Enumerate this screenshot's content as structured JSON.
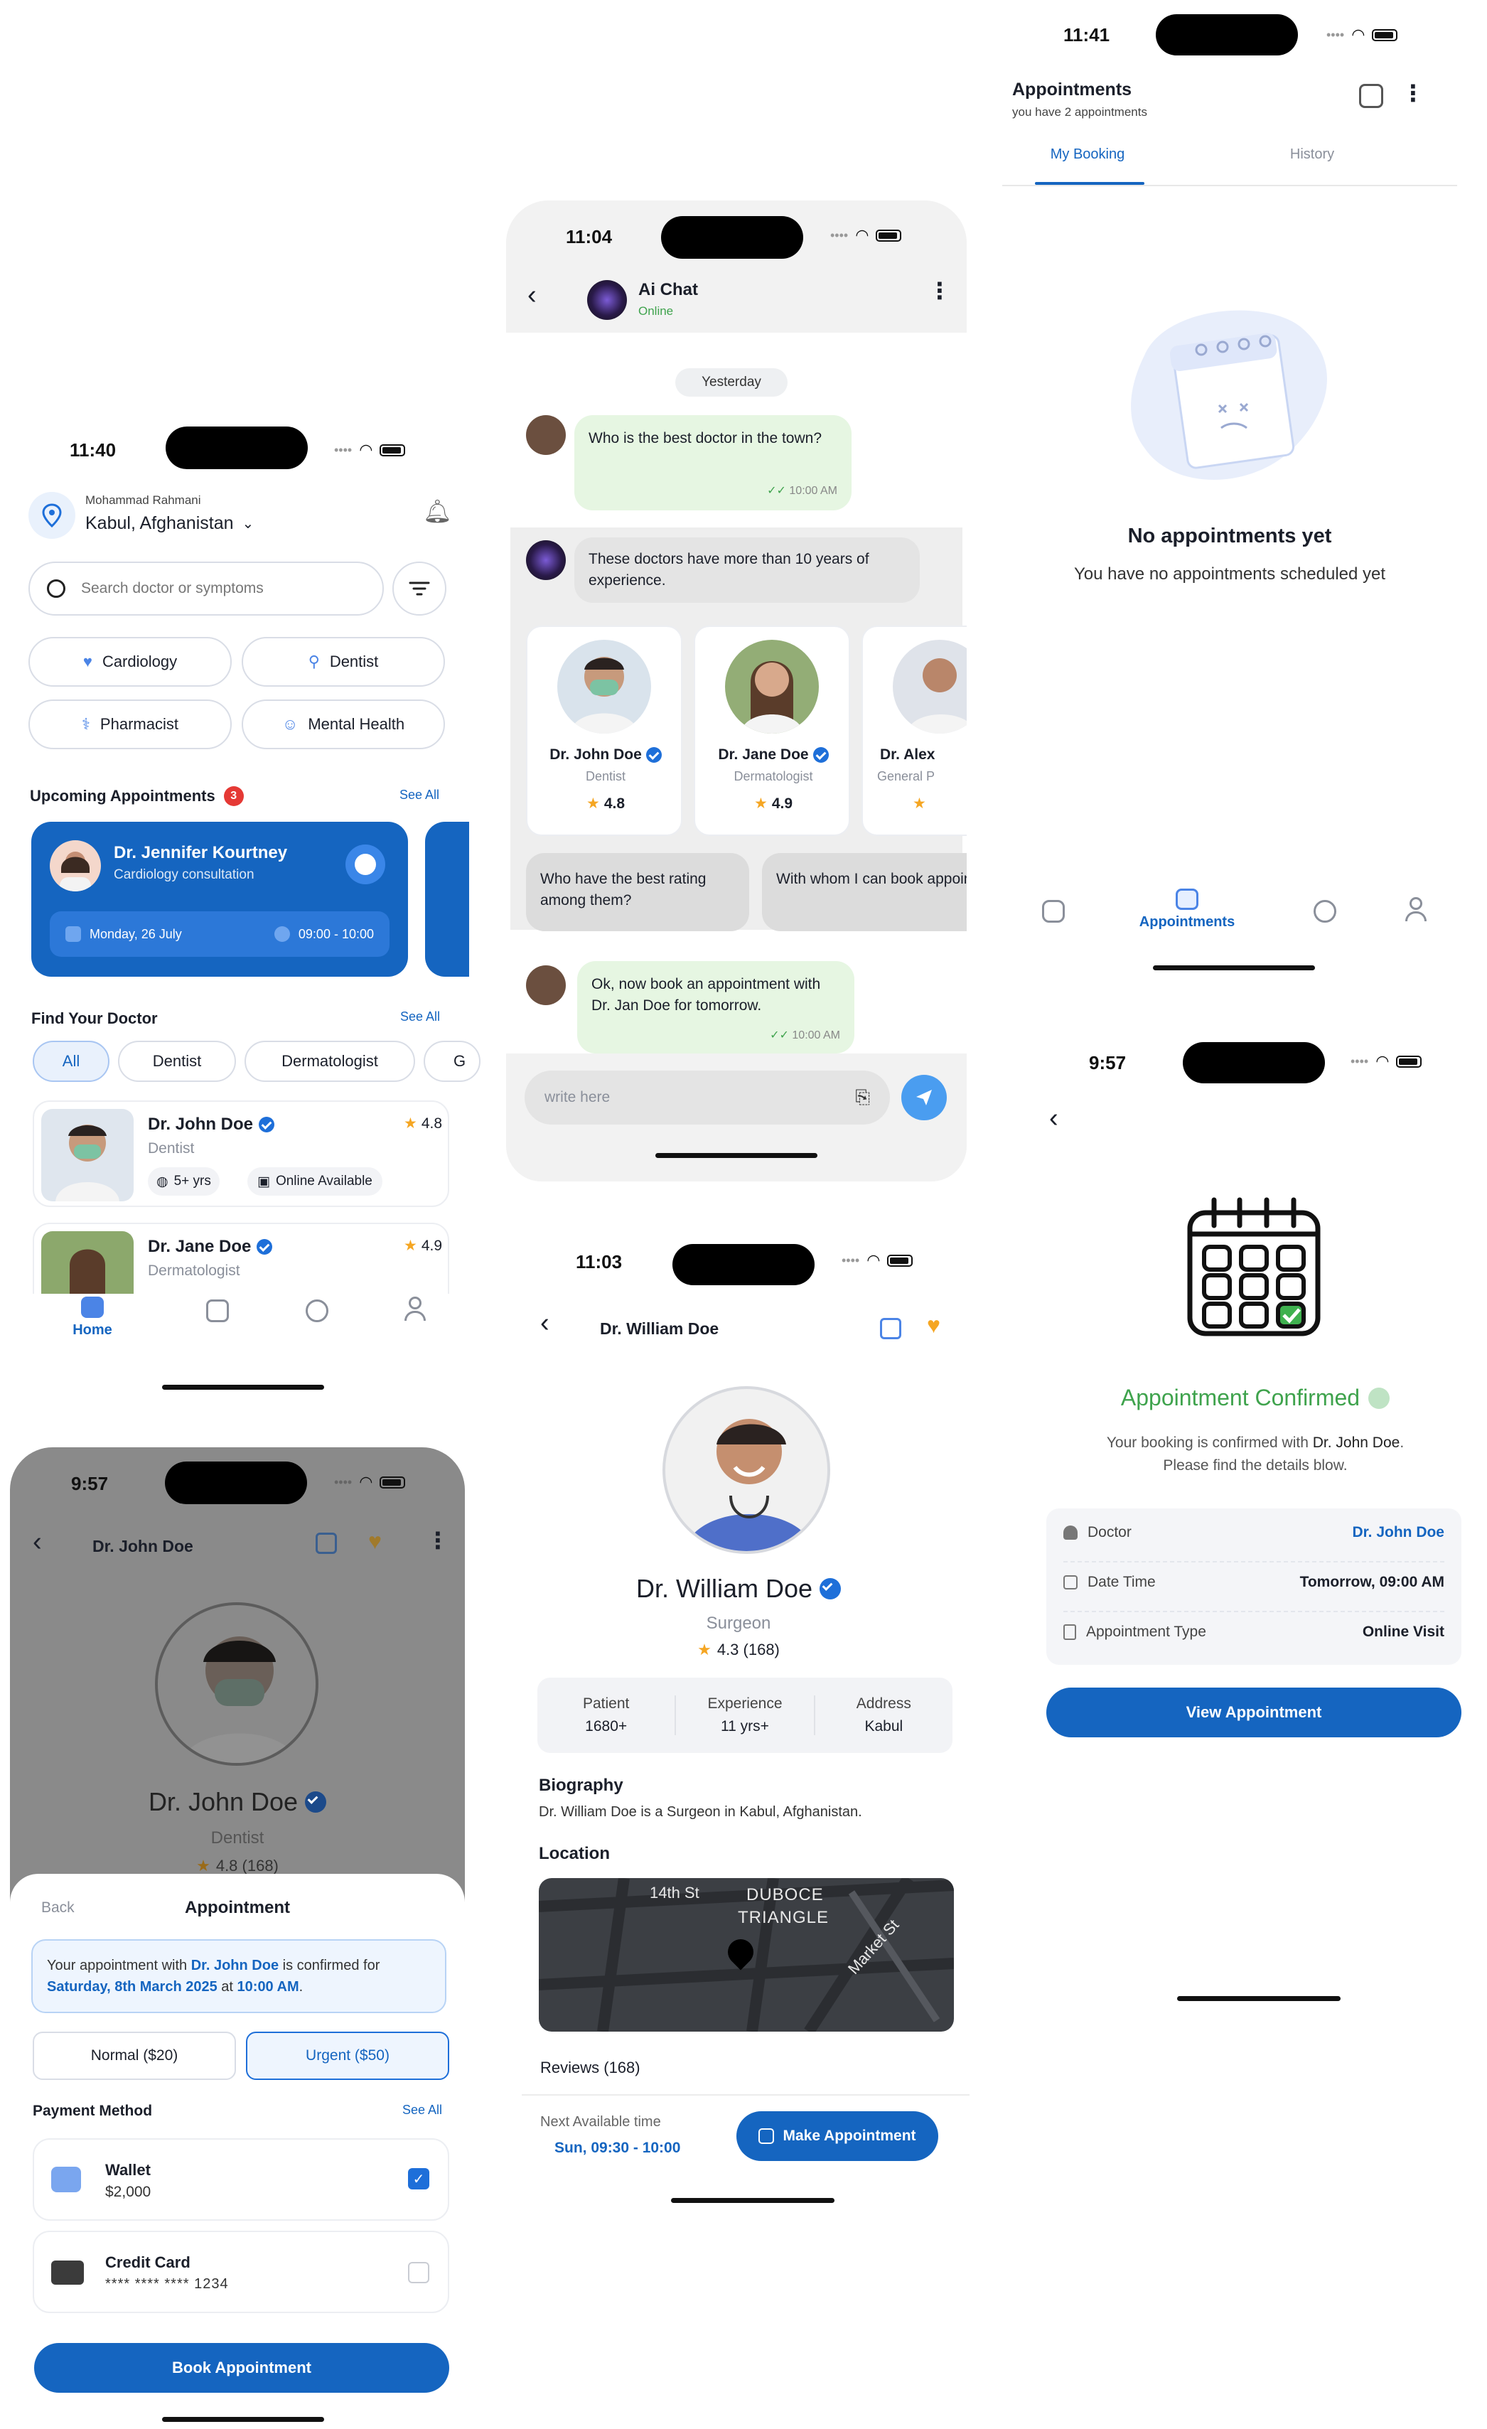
{
  "home": {
    "time": "11:40",
    "user_name": "Mohammad Rahmani",
    "location": "Kabul, Afghanistan",
    "search_placeholder": "Search doctor or symptoms",
    "categories": [
      "Cardiology",
      "Dentist",
      "Pharmacist",
      "Mental Health"
    ],
    "upcoming_title": "Upcoming Appointments",
    "upcoming_count": "3",
    "see_all": "See All",
    "appt": {
      "doctor": "Dr. Jennifer Kourtney",
      "type": "Cardiology consultation",
      "date": "Monday, 26 July",
      "time": "09:00 - 10:00"
    },
    "find_title": "Find Your Doctor",
    "filters": [
      "All",
      "Dentist",
      "Dermatologist",
      "G"
    ],
    "doctors": [
      {
        "name": "Dr. John Doe",
        "specialty": "Dentist",
        "rating": "4.8",
        "experience": "5+ yrs",
        "availability": "Online Available"
      },
      {
        "name": "Dr. Jane Doe",
        "specialty": "Dermatologist",
        "rating": "4.9"
      }
    ],
    "nav_home": "Home"
  },
  "chat": {
    "time": "11:04",
    "title": "Ai Chat",
    "status": "Online",
    "day": "Yesterday",
    "msg1": "Who is the best doctor in the town?",
    "msg1_time": "10:00 AM",
    "reply1": "These doctors have more than 10 years of experience.",
    "cards": [
      {
        "name": "Dr. John Doe",
        "specialty": "Dentist",
        "rating": "4.8"
      },
      {
        "name": "Dr. Jane Doe",
        "specialty": "Dermatologist",
        "rating": "4.9"
      },
      {
        "name": "Dr. Alex",
        "specialty": "General P"
      }
    ],
    "suggest1": "Who have the best rating among them?",
    "suggest2": "With whom I can book appointment today?",
    "msg2": "Ok, now book an appointment with Dr. Jan Doe for tomorrow.",
    "msg2_time": "10:00 AM",
    "input_placeholder": "write here"
  },
  "appointments": {
    "time": "11:41",
    "title": "Appointments",
    "subtitle": "you have 2 appointments",
    "tab_active": "My Booking",
    "tab_other": "History",
    "empty_title": "No appointments yet",
    "empty_text": "You have no appointments scheduled yet",
    "nav_active": "Appointments"
  },
  "booking": {
    "time": "9:57",
    "doctor_header": "Dr. John Doe",
    "doctor_name": "Dr. John Doe",
    "specialty": "Dentist",
    "rating": "4.8 (168)",
    "back": "Back",
    "sheet_title": "Appointment",
    "confirm_pre": "Your appointment with ",
    "confirm_doctor": "Dr. John Doe",
    "confirm_mid": " is confirmed for ",
    "confirm_date": "Saturday, 8th March 2025",
    "confirm_at": " at ",
    "confirm_time": "10:00 AM",
    "confirm_end": ".",
    "normal": "Normal ($20)",
    "urgent": "Urgent ($50)",
    "payment_title": "Payment Method",
    "see_all": "See All",
    "wallet": "Wallet",
    "wallet_amount": "$2,000",
    "card": "Credit Card",
    "card_number": "**** **** **** 1234",
    "book_button": "Book Appointment"
  },
  "profile": {
    "time": "11:03",
    "header": "Dr. William Doe",
    "name": "Dr. William Doe",
    "specialty": "Surgeon",
    "rating": "4.3 (168)",
    "stats": [
      {
        "label": "Patient",
        "value": "1680+"
      },
      {
        "label": "Experience",
        "value": "11 yrs+"
      },
      {
        "label": "Address",
        "value": "Kabul"
      }
    ],
    "bio_title": "Biography",
    "bio": "Dr. William Doe is a Surgeon in Kabul, Afghanistan.",
    "location_title": "Location",
    "map_labels": [
      "14th St",
      "DUBOCE",
      "TRIANGLE",
      "Market St"
    ],
    "reviews": "Reviews (168)",
    "next_label": "Next Available time",
    "next_value": "Sun, 09:30 - 10:00",
    "make_button": "Make Appointment"
  },
  "confirmed": {
    "time": "9:57",
    "title": "Appointment Confirmed",
    "text_pre": "Your booking is confirmed with ",
    "text_doctor": "Dr. John Doe",
    "text_post": ".",
    "text_line2": "Please find the details blow.",
    "rows": [
      {
        "label": "Doctor",
        "value": "Dr. John Doe"
      },
      {
        "label": "Date Time",
        "value": "Tomorrow, 09:00 AM"
      },
      {
        "label": "Appointment Type",
        "value": "Online Visit"
      }
    ],
    "button": "View Appointment"
  },
  "colors": {
    "primary": "#1565c0",
    "chat_green": "#e6f6e2",
    "confirm_green": "#3fa34d"
  }
}
